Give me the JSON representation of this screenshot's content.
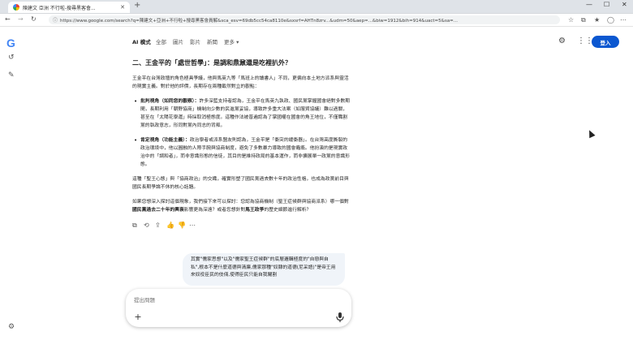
{
  "browser": {
    "tab_title": "陳建文 亞洲 不行啦-搜尋黑客會...",
    "url": "https://www.google.com/search?q=陳建文+亞洲+不行啦+搜尋黑客會員解&sca_esv=69db5cc54ca8110e&sxsrf=AHTn8zrv...&udm=50&aep=...&biw=1912&bih=914&uact=5&sa=...",
    "new_tab": "+",
    "close_tab": "✕"
  },
  "search_tabs": [
    {
      "label": "AI 模式",
      "active": true
    },
    {
      "label": "全部"
    },
    {
      "label": "圖片"
    },
    {
      "label": "影片"
    },
    {
      "label": "新聞"
    },
    {
      "label": "更多 ▾"
    }
  ],
  "header": {
    "sign_in": "登入"
  },
  "content": {
    "heading": "二、王金平的「處世哲學」：是調和鼎鼐還是吃裡扒外？",
    "intro": "王金平在台灣政壇的角色極具爭議，他與馬英九等「馬班上的讀書人」不同，更偏向本土地方派系與靈活的現實主義。對於他的評價，長期存在兩種截然對立的觀點：",
    "bullet1_title": "批判視角（如同您的觀察）：",
    "bullet1_text": "許多深藍支持者認為，王金平在馬英九執政、國民黨掌握國會絕對多數期間，長期利用「朝野協商」機制向少數的民進黨妥協，導致許多重大法案（如服貿協議）難以過關，甚至在「太陽花學運」時採取消極態度。這種作法被普遍認為了掌國權在國會的角王地位，不僅職割黨的執政意志，形同對黨內同志的背叛。",
    "bullet2_title": "肯定視角（功能主義）：",
    "bullet2_text": "政治學者或派系盟友則認為，王金平是「衝突的緩衝器」。在台灣高度撕裂的政治環境中，他以圓融的人際手腕與協商制度，避免了多數暴力導致的國會癱瘓。他扮演的是現實政治中的「調和者」，而非意識形態的信徒，其目的是維持政局的基本運作，而非擴展單一政黨的意識形態。",
    "summary": "這種「聖王心態」與「協商政治」的交織，確實形塑了國民黨過去數十年的政治性格，也成為政黨前目與國民長期爭論不休的核心話題。",
    "followup_a": "如果您想深入探討這個現象，我們接下來可以探討：您認為協商機制（聖王症候群與協商派系）哪一個對",
    "followup_b": "國民黨過去二十年的興衰",
    "followup_c": "影響更為深遠？或者您想針對",
    "followup_d": "馬王政爭",
    "followup_e": "的歷史細節進行解析？"
  },
  "user_message": "其實\"儒家思想\"以及\"儒家聖王症候群\"的底層邏輯極度的\"自戀與自私\",根本不是什麼道德與清廉,儒家那種\"奴隸的道德(尼采語)\"是帝王用來奴役臣民的伎倆,使得臣民只能自我閹割",
  "input": {
    "placeholder": "提出問題"
  },
  "icons": {
    "back": "back-icon",
    "forward": "forward-icon",
    "refresh": "refresh-icon",
    "copy": "copy-icon",
    "share": "share-icon",
    "thumbs_up": "thumbs-up-icon",
    "thumbs_down": "thumbs-down-icon",
    "more": "more-icon",
    "mic": "mic-icon",
    "plus": "plus-icon",
    "settings": "gear-icon",
    "apps": "apps-icon"
  },
  "colors": {
    "accent": "#0b57d0",
    "bubble": "#f0f4f9"
  }
}
